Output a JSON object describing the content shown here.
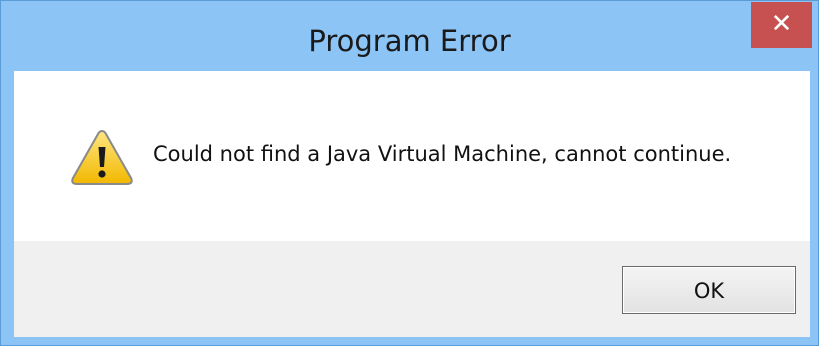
{
  "window": {
    "title": "Program Error",
    "close_glyph": "✕"
  },
  "dialog": {
    "icon": "warning-icon",
    "message": "Could not find a Java Virtual Machine, cannot continue.",
    "ok_label": "OK"
  },
  "colors": {
    "titlebar": "#8cc4f5",
    "close_button": "#c75050",
    "button_area": "#f0f0f0",
    "warning_yellow": "#f5c400"
  }
}
